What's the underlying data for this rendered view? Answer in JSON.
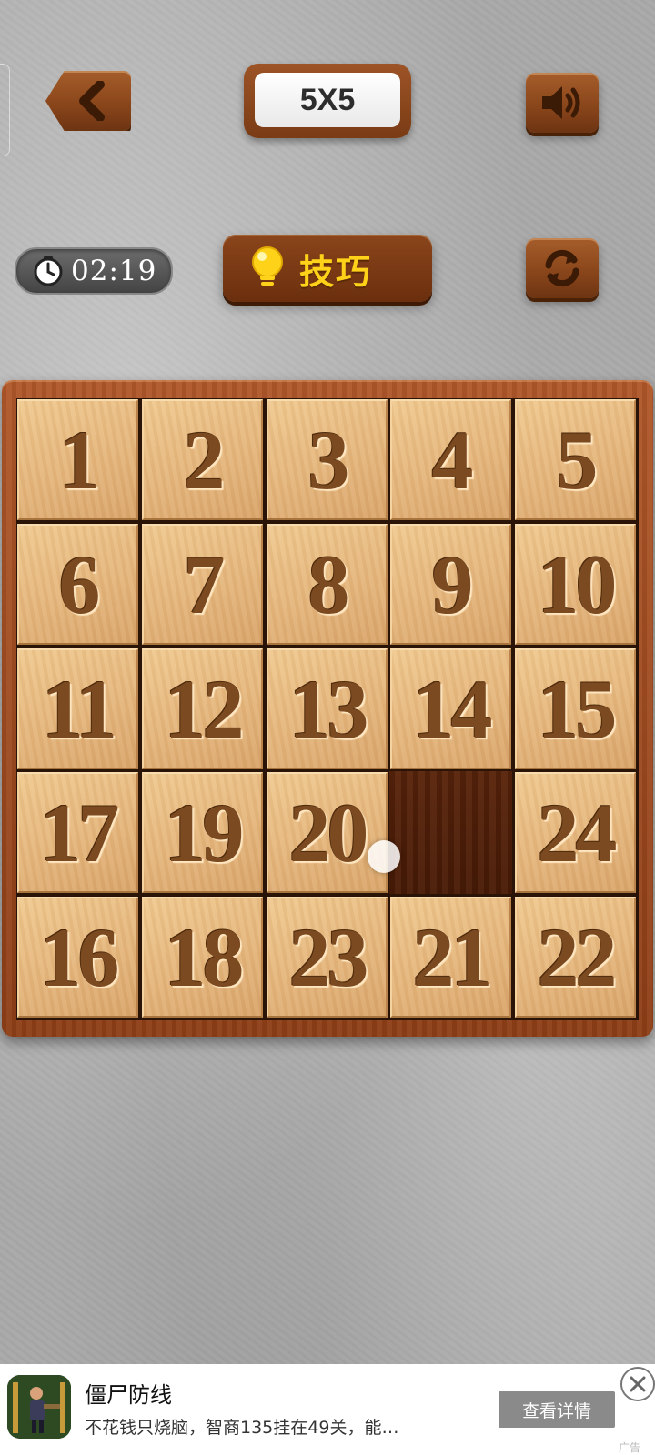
{
  "header": {
    "level_label": "5X5",
    "back_icon": "chevron-left-icon",
    "sound_icon": "speaker-icon",
    "refresh_icon": "refresh-icon"
  },
  "toolbar": {
    "timer": "02:19",
    "timer_icon": "clock-icon",
    "hint_label": "技巧",
    "hint_icon": "lightbulb-icon"
  },
  "board": {
    "size": 5,
    "grid": [
      [
        1,
        2,
        3,
        4,
        5
      ],
      [
        6,
        7,
        8,
        9,
        10
      ],
      [
        11,
        12,
        13,
        14,
        15
      ],
      [
        17,
        19,
        20,
        null,
        24
      ],
      [
        16,
        18,
        23,
        21,
        22
      ]
    ],
    "empty_cell": [
      3,
      3
    ]
  },
  "ad": {
    "title": "僵尸防线",
    "description": "不花钱只烧脑，智商135挂在49关，能…",
    "button_label": "查看详情",
    "tag": "广告"
  },
  "colors": {
    "wood_button": "#8a461b",
    "tile_face": "#e4b47a",
    "tile_number": "#7c4a20",
    "empty_slot": "#4a1c07",
    "hint_text": "#ffd21a"
  }
}
